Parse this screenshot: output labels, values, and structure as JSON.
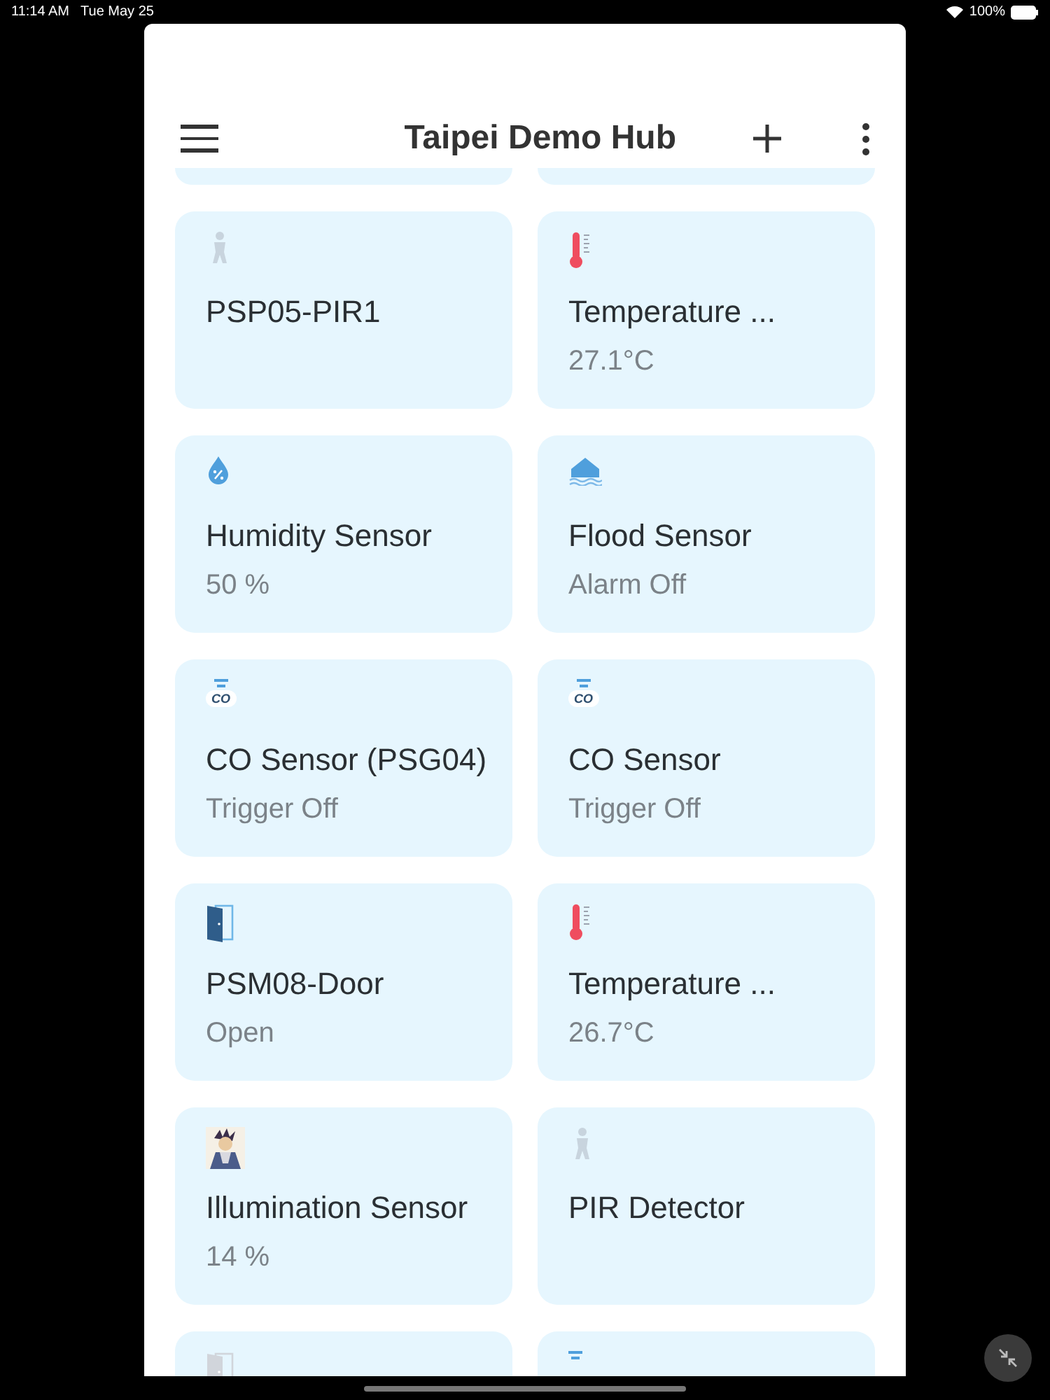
{
  "status_bar": {
    "time": "11:14 AM",
    "date": "Tue May 25",
    "battery": "100%"
  },
  "header": {
    "title": "Taipei Demo Hub"
  },
  "cards": [
    {
      "kind": "motion",
      "active": false,
      "title": "PSP05-PIR1"
    },
    {
      "kind": "thermometer",
      "active": true,
      "title": "Temperature ...",
      "value": "27.1°C"
    },
    {
      "kind": "humidity",
      "active": true,
      "title": "Humidity Sensor",
      "value": "50 %"
    },
    {
      "kind": "flood",
      "active": true,
      "title": "Flood Sensor",
      "value": "Alarm Off"
    },
    {
      "kind": "co",
      "active": true,
      "badge": "CO",
      "title": "CO Sensor (PSG04)",
      "value": "Trigger Off"
    },
    {
      "kind": "co",
      "active": true,
      "badge": "CO",
      "title": "CO Sensor",
      "value": "Trigger Off"
    },
    {
      "kind": "door",
      "active": true,
      "title": "PSM08-Door",
      "value": "Open"
    },
    {
      "kind": "thermometer",
      "active": true,
      "title": "Temperature ...",
      "value": "26.7°C"
    },
    {
      "kind": "picture",
      "active": true,
      "title": "Illumination Sensor",
      "value": "14 %"
    },
    {
      "kind": "motion",
      "active": false,
      "title": "PIR Detector"
    },
    {
      "kind": "door",
      "active": false
    },
    {
      "kind": "co",
      "active": true
    }
  ]
}
